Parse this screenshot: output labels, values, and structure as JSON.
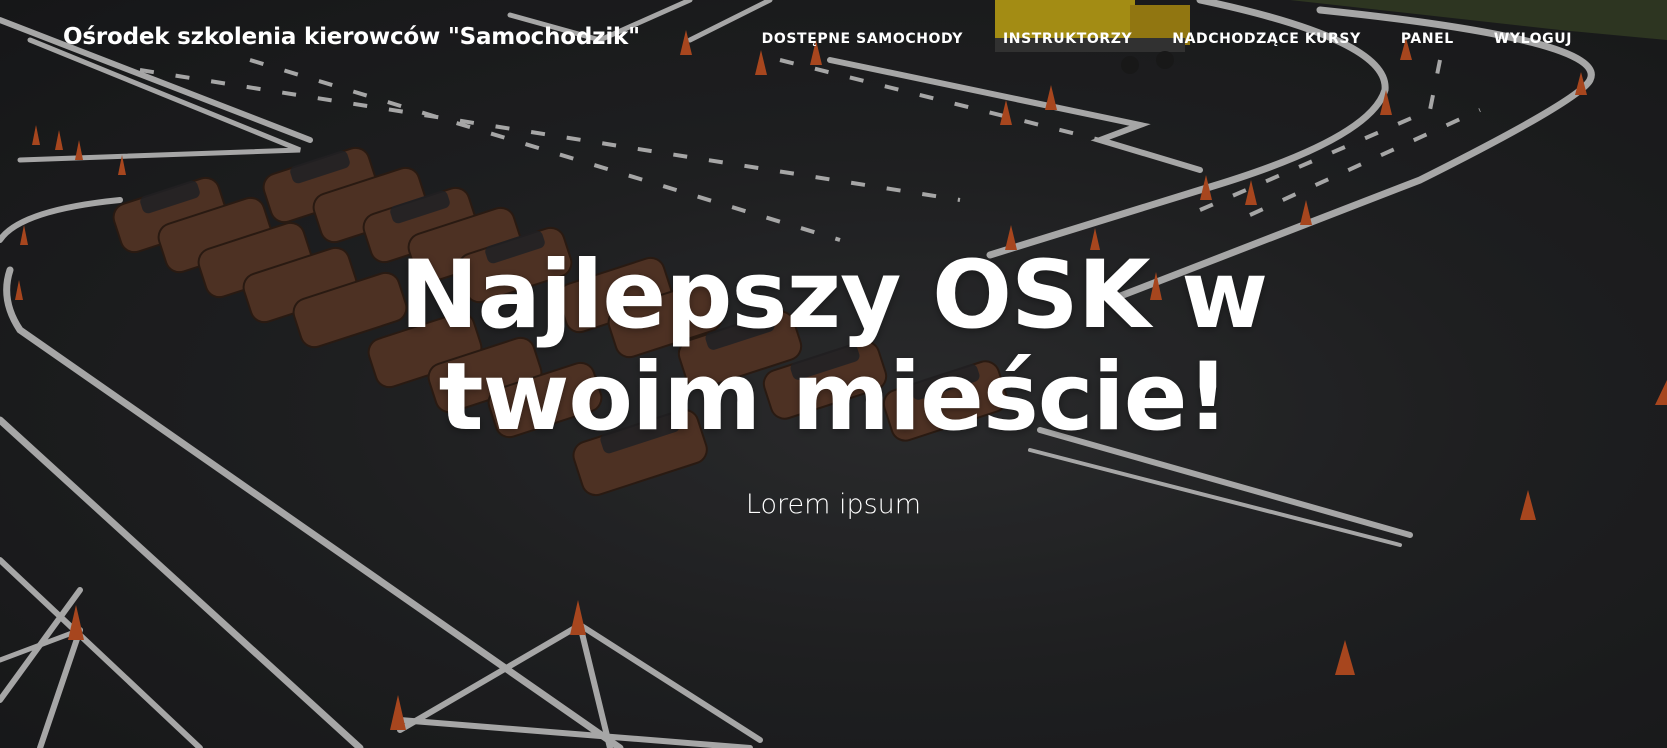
{
  "header": {
    "brand": "Ośrodek szkolenia kierowców \"Samochodzik\""
  },
  "nav": {
    "items": [
      {
        "label": "DOSTĘPNE SAMOCHODY"
      },
      {
        "label": "INSTRUKTORZY"
      },
      {
        "label": "NADCHODZĄCE KURSY"
      },
      {
        "label": "PANEL"
      },
      {
        "label": "WYLOGUJ"
      }
    ]
  },
  "hero": {
    "title_line1": "Najlepszy OSK w",
    "title_line2": "twoim mieście!",
    "subtitle": "Lorem ipsum",
    "background_image": "driving-school-training-yard-with-cars-photo"
  },
  "colors": {
    "text": "#ffffff",
    "asphalt": "#2d2e30",
    "road_lines": "#e8e8e8",
    "cone": "#e8622a",
    "car": "#6b4431",
    "truck": "#e2c21c"
  }
}
